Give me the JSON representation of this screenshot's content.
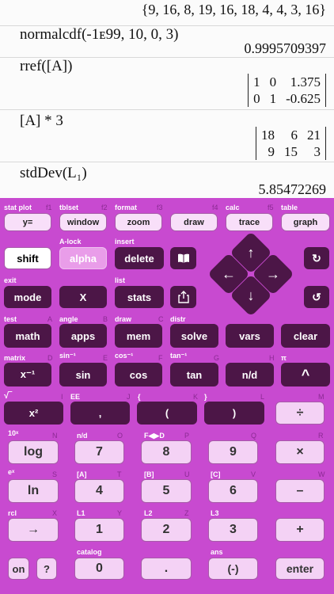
{
  "history": [
    {
      "expr": "",
      "result": "{9, 16, 8, 19, 16, 18, 4, 4, 3, 16}"
    },
    {
      "expr": "normalcdf(-1ᴇ99, 10, 0, 3)",
      "result": "0.9995709397"
    },
    {
      "expr": "rref([A])",
      "matrix": [
        [
          "1",
          "0",
          "1.375"
        ],
        [
          "0",
          "1",
          "-0.625"
        ]
      ]
    },
    {
      "expr": "[A] * 3",
      "matrix": [
        [
          "18",
          "6",
          "21"
        ],
        [
          "9",
          "15",
          "3"
        ]
      ]
    },
    {
      "expr": "stdDev(L₁)",
      "result": "5.85472269"
    }
  ],
  "labels": {
    "stat_plot": "stat plot",
    "f1": "f1",
    "tblset": "tblset",
    "f2": "f2",
    "format": "format",
    "f3": "f3",
    "f4": "f4",
    "calc": "calc",
    "f5": "f5",
    "table": "table",
    "alock": "A-lock",
    "insert": "insert",
    "exit": "exit",
    "list": "list",
    "test": "test",
    "A": "A",
    "angle": "angle",
    "B": "B",
    "draw": "draw",
    "C": "C",
    "distr": "distr",
    "matrix": "matrix",
    "D": "D",
    "sin_inv": "sin⁻¹",
    "E": "E",
    "cos_inv": "cos⁻¹",
    "F": "F",
    "tan_inv": "tan⁻¹",
    "G": "G",
    "H": "H",
    "pi": "π",
    "sqrt": "√‾",
    "I": "I",
    "EE": "EE",
    "J": "J",
    "lbrace": "{",
    "K": "K",
    "rbrace": "}",
    "L": "L",
    "M": "M",
    "tenx": "10ˣ",
    "N": "N",
    "nd": "n/d",
    "O": "O",
    "fdfrac": "F◀▶D",
    "P": "P",
    "Q": "Q",
    "R": "R",
    "ex": "eˣ",
    "S": "S",
    "A_mat": "[A]",
    "T": "T",
    "B_mat": "[B]",
    "U": "U",
    "C_mat": "[C]",
    "V": "V",
    "W": "W",
    "rcl": "rcl",
    "X": "X",
    "L1": "L1",
    "Y": "Y",
    "L2": "L2",
    "Z": "Z",
    "L3": "L3",
    "catalog": "catalog",
    "ans": "ans"
  },
  "keys": {
    "y_eq": "y=",
    "window": "window",
    "zoom": "zoom",
    "draw": "draw",
    "trace": "trace",
    "graph": "graph",
    "shift": "shift",
    "alpha": "alpha",
    "delete": "delete",
    "book": "📖",
    "redo": "↻",
    "mode": "mode",
    "x": "X",
    "stats": "stats",
    "share": "⬆",
    "undo": "↺",
    "math": "math",
    "apps": "apps",
    "mem": "mem",
    "solve": "solve",
    "vars": "vars",
    "clear": "clear",
    "xinv": "x⁻¹",
    "sin": "sin",
    "cos": "cos",
    "tan": "tan",
    "nd": "n/d",
    "caret": "^",
    "xsq": "x²",
    "comma": ",",
    "lparen": "(",
    "rparen": ")",
    "div": "÷",
    "log": "log",
    "seven": "7",
    "eight": "8",
    "nine": "9",
    "mul": "×",
    "ln": "ln",
    "four": "4",
    "five": "5",
    "six": "6",
    "minus": "–",
    "sto": "→",
    "one": "1",
    "two": "2",
    "three": "3",
    "plus": "+",
    "on": "on",
    "help": "?",
    "zero": "0",
    "dot": ".",
    "neg": "(-)",
    "enter": "enter"
  },
  "dpad": {
    "up": "↑",
    "down": "↓",
    "left": "←",
    "right": "→"
  }
}
